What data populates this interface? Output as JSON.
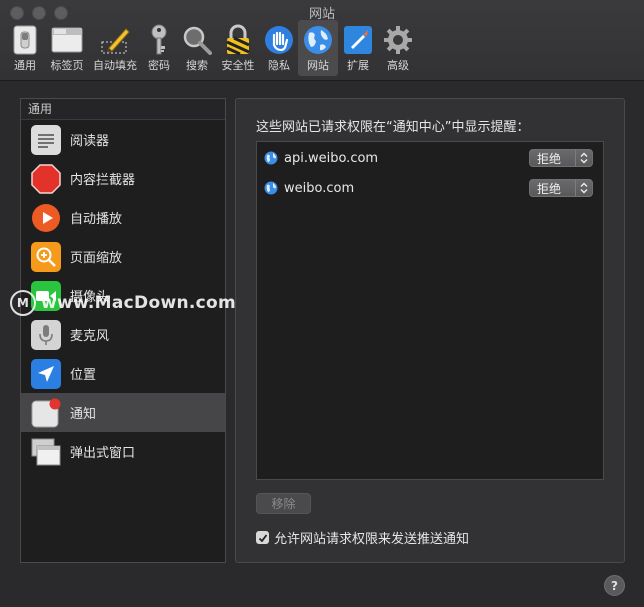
{
  "window": {
    "title": "网站"
  },
  "toolbar": {
    "items": [
      {
        "label": "通用",
        "icon": "general-switch-icon"
      },
      {
        "label": "标签页",
        "icon": "tabs-icon"
      },
      {
        "label": "自动填充",
        "icon": "autofill-pencil-icon"
      },
      {
        "label": "密码",
        "icon": "key-icon"
      },
      {
        "label": "搜索",
        "icon": "magnifier-icon"
      },
      {
        "label": "安全性",
        "icon": "lock-icon"
      },
      {
        "label": "隐私",
        "icon": "hand-icon"
      },
      {
        "label": "网站",
        "icon": "globe-icon",
        "active": true
      },
      {
        "label": "扩展",
        "icon": "extension-icon"
      },
      {
        "label": "高级",
        "icon": "gear-icon"
      }
    ]
  },
  "sidebar": {
    "header": "通用",
    "items": [
      {
        "label": "阅读器",
        "icon": "reader-icon"
      },
      {
        "label": "内容拦截器",
        "icon": "stop-sign-icon"
      },
      {
        "label": "自动播放",
        "icon": "play-icon"
      },
      {
        "label": "页面缩放",
        "icon": "zoom-icon"
      },
      {
        "label": "摄像头",
        "icon": "camera-icon"
      },
      {
        "label": "麦克风",
        "icon": "microphone-icon"
      },
      {
        "label": "位置",
        "icon": "location-arrow-icon"
      },
      {
        "label": "通知",
        "icon": "notification-icon",
        "selected": true
      },
      {
        "label": "弹出式窗口",
        "icon": "popup-window-icon"
      }
    ]
  },
  "panel": {
    "description": "这些网站已请求权限在“通知中心”中显示提醒：",
    "sites": [
      {
        "name": "api.weibo.com",
        "setting": "拒绝"
      },
      {
        "name": "weibo.com",
        "setting": "拒绝"
      }
    ],
    "remove_label": "移除",
    "allow_label": "允许网站请求权限来发送推送通知",
    "allow_checked": true
  },
  "help": {
    "label": "?"
  },
  "watermark": {
    "text": "www.MacDown.com"
  },
  "colors": {
    "accent_blue": "#2f7fe0",
    "window_bg": "#2a2a2c",
    "list_bg": "#1e1e1f",
    "selected_row": "#464649"
  }
}
